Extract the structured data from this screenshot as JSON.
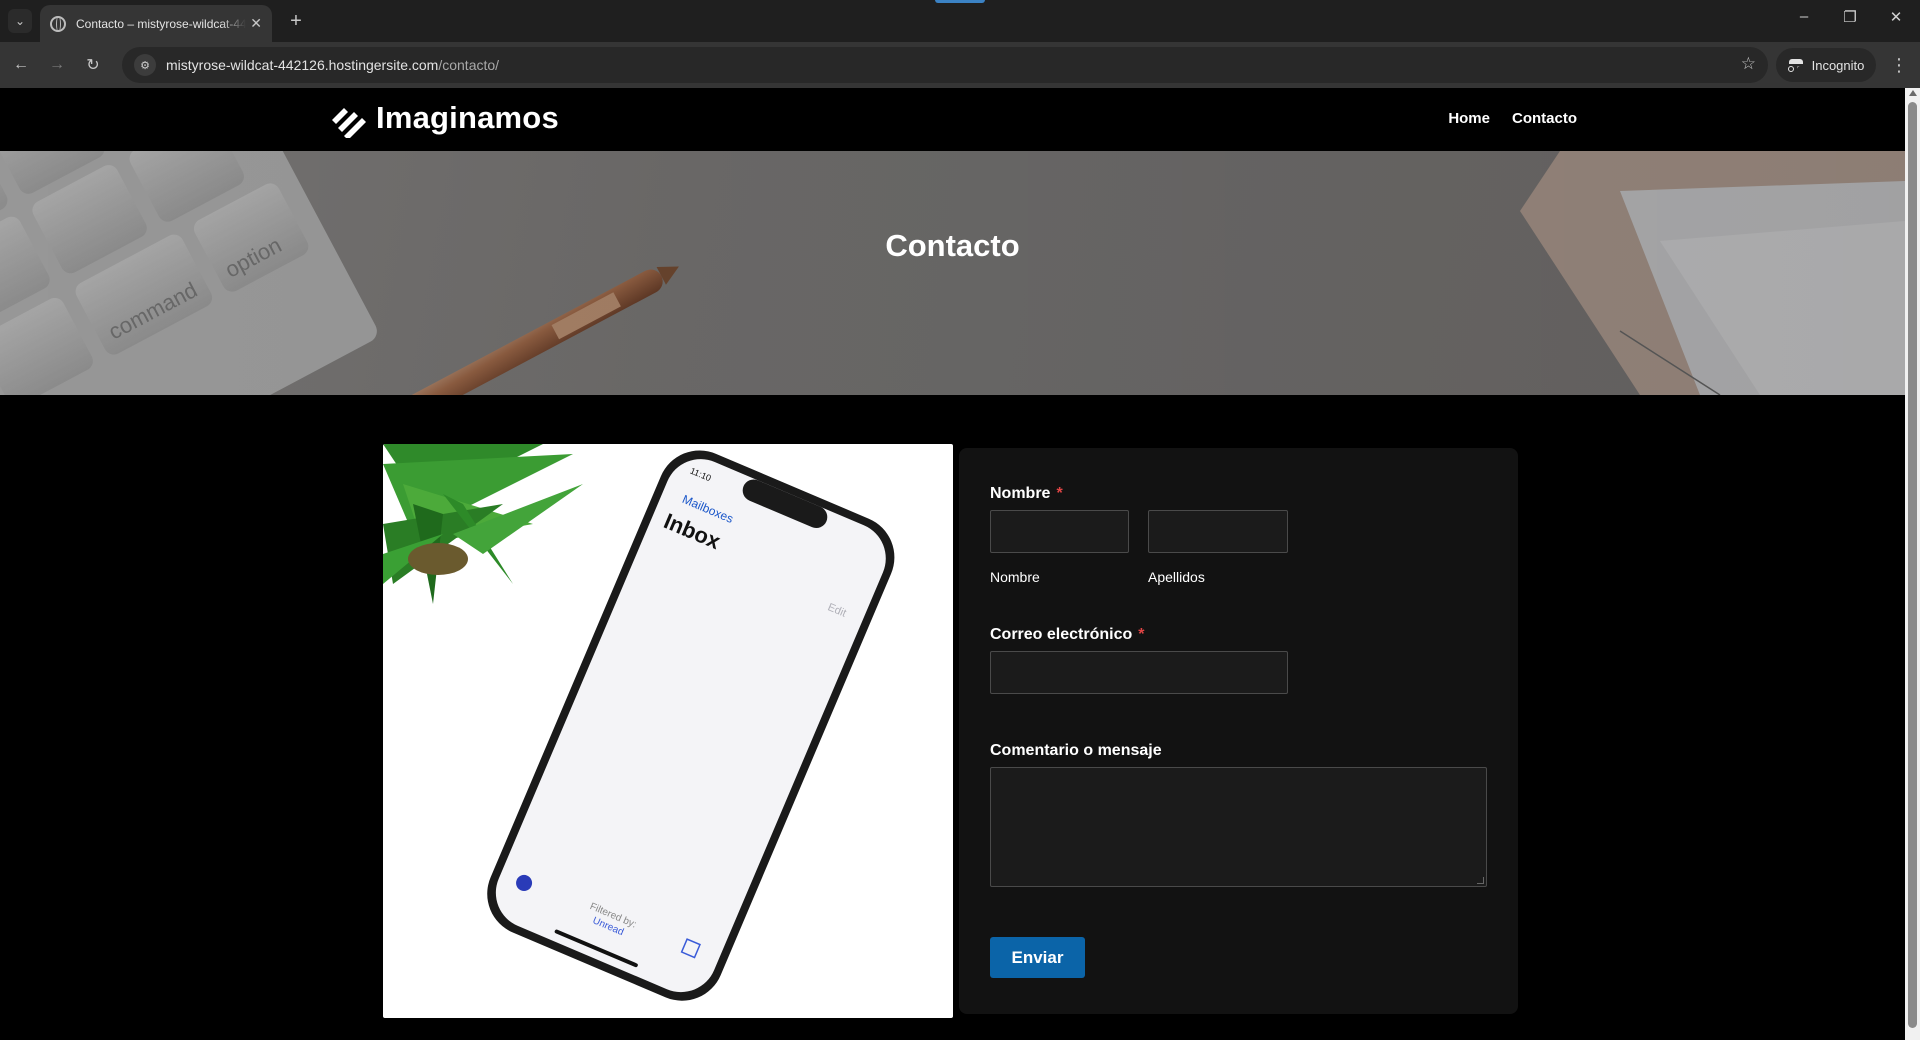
{
  "browser": {
    "tab_title": "Contacto – mistyrose-wildcat-442126.hostingersite.com",
    "url_host": "mistyrose-wildcat-442126.hostingersite.com",
    "url_path": "/contacto/",
    "incognito_label": "Incognito"
  },
  "site": {
    "logo_text": "Imaginamos",
    "nav": [
      "Home",
      "Contacto"
    ]
  },
  "hero": {
    "title": "Contacto",
    "keyboard_keys": [
      "command",
      "option"
    ]
  },
  "phone_screen": {
    "time": "11:10",
    "back_label": "Mailboxes",
    "title": "Inbox",
    "edit_label": "Edit",
    "filter_label": "Filtered by:",
    "filter_value": "Unread"
  },
  "form": {
    "name_label": "Nombre",
    "required_mark": "*",
    "first_name_caption": "Nombre",
    "last_name_caption": "Apellidos",
    "email_label": "Correo electrónico",
    "message_label": "Comentario o mensaje",
    "submit_label": "Enviar"
  },
  "colors": {
    "accent_button": "#0b64a8",
    "required": "#e04545",
    "form_bg": "#121212"
  }
}
